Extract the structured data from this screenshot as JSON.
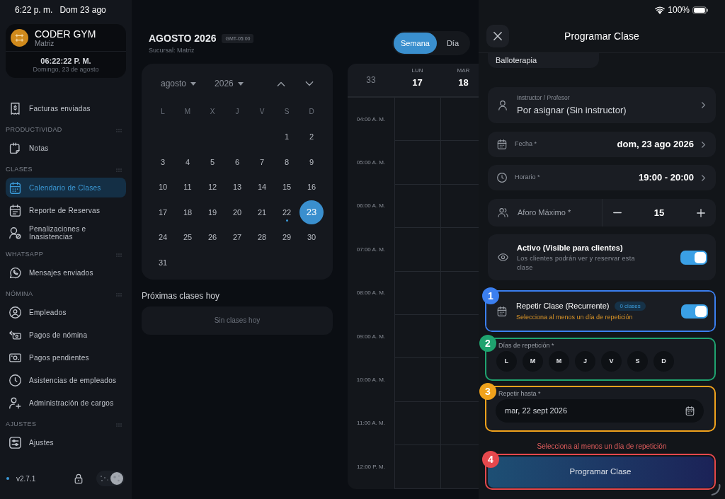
{
  "status_bar": {
    "time": "6:22 p. m.",
    "date": "Dom 23 ago",
    "battery": "100%"
  },
  "sidebar": {
    "brand": {
      "name": "CODER GYM",
      "branch": "Matriz",
      "clock": "06:22:22 P. M.",
      "date": "Domingo, 23 de agosto"
    },
    "sections": [
      {
        "items": [
          {
            "label": "Facturas enviadas",
            "selected": false
          }
        ]
      },
      {
        "title": "PRODUCTIVIDAD",
        "items": [
          {
            "label": "Notas",
            "selected": false
          }
        ]
      },
      {
        "title": "CLASES",
        "items": [
          {
            "label": "Calendario de Clases",
            "selected": true
          },
          {
            "label": "Reporte de Reservas",
            "selected": false
          },
          {
            "label": "Penalizaciones e Inasistencias",
            "selected": false
          }
        ]
      },
      {
        "title": "WHATSAPP",
        "items": [
          {
            "label": "Mensajes enviados",
            "selected": false
          }
        ]
      },
      {
        "title": "NÓMINA",
        "items": [
          {
            "label": "Empleados",
            "selected": false
          },
          {
            "label": "Pagos de nómina",
            "selected": false
          },
          {
            "label": "Pagos pendientes",
            "selected": false
          },
          {
            "label": "Asistencias de empleados",
            "selected": false
          },
          {
            "label": "Administración de cargos",
            "selected": false
          }
        ]
      },
      {
        "title": "AJUSTES",
        "items": [
          {
            "label": "Ajustes",
            "selected": false
          }
        ]
      }
    ],
    "version": "v2.7.1",
    "dark_mode": true
  },
  "header": {
    "title": "AGOSTO 2026",
    "timezone": "GMT-05:00",
    "branch": "Sucursal: Matriz"
  },
  "view_switch": [
    {
      "label": "Semana",
      "selected": true
    },
    {
      "label": "Día",
      "selected": false
    }
  ],
  "mini_calendar": {
    "month": "agosto",
    "year": "2026",
    "weekdays": [
      "L",
      "M",
      "X",
      "J",
      "V",
      "S",
      "D"
    ],
    "weeks": [
      [
        {
          "day": "1",
          "selected": false,
          "has_class": false
        },
        {
          "day": "2",
          "selected": false,
          "has_class": false
        }
      ],
      [
        {
          "day": "3",
          "selected": false,
          "has_class": false
        },
        {
          "day": "4",
          "selected": false,
          "has_class": false
        },
        {
          "day": "5",
          "selected": false,
          "has_class": false
        },
        {
          "day": "6",
          "selected": false,
          "has_class": false
        },
        {
          "day": "7",
          "selected": false,
          "has_class": false
        },
        {
          "day": "8",
          "selected": false,
          "has_class": false
        },
        {
          "day": "9",
          "selected": false,
          "has_class": false
        }
      ],
      [
        {
          "day": "10",
          "selected": false,
          "has_class": false
        },
        {
          "day": "11",
          "selected": false,
          "has_class": false
        },
        {
          "day": "12",
          "selected": false,
          "has_class": false
        },
        {
          "day": "13",
          "selected": false,
          "has_class": false
        },
        {
          "day": "14",
          "selected": false,
          "has_class": false
        },
        {
          "day": "15",
          "selected": false,
          "has_class": false
        },
        {
          "day": "16",
          "selected": false,
          "has_class": false
        }
      ],
      [
        {
          "day": "17",
          "selected": false,
          "has_class": false
        },
        {
          "day": "18",
          "selected": false,
          "has_class": false
        },
        {
          "day": "19",
          "selected": false,
          "has_class": false
        },
        {
          "day": "20",
          "selected": false,
          "has_class": false
        },
        {
          "day": "21",
          "selected": false,
          "has_class": false
        },
        {
          "day": "22",
          "selected": false,
          "has_class": true
        },
        {
          "day": "23",
          "selected": true,
          "has_class": false
        }
      ],
      [
        {
          "day": "24",
          "selected": false,
          "has_class": false
        },
        {
          "day": "25",
          "selected": false,
          "has_class": false
        },
        {
          "day": "26",
          "selected": false,
          "has_class": false
        },
        {
          "day": "27",
          "selected": false,
          "has_class": false
        },
        {
          "day": "28",
          "selected": false,
          "has_class": false
        },
        {
          "day": "29",
          "selected": false,
          "has_class": false
        },
        {
          "day": "30",
          "selected": false,
          "has_class": false
        }
      ],
      [
        {
          "day": "31",
          "selected": false,
          "has_class": false
        }
      ]
    ]
  },
  "upcoming": {
    "title": "Próximas clases hoy",
    "empty_text": "Sin clases hoy"
  },
  "week_view": {
    "week_number": "33",
    "days": [
      {
        "weekday": "LUN",
        "date": "17"
      },
      {
        "weekday": "MAR",
        "date": "18"
      }
    ],
    "hours": [
      "04:00 A. M.",
      "05:00 A. M.",
      "06:00 A. M.",
      "07:00 A. M.",
      "08:00 A. M.",
      "09:00 A. M.",
      "10:00 A. M.",
      "11:00 A. M.",
      "12:00 P. M."
    ]
  },
  "panel": {
    "title": "Programar Clase",
    "class_name": "Balloterapia",
    "instructor": {
      "label": "Instructor / Profesor",
      "value": "Por asignar (Sin instructor)"
    },
    "date": {
      "label": "Fecha *",
      "value": "dom, 23 ago 2026"
    },
    "time": {
      "label": "Horario *",
      "value": "19:00 - 20:00"
    },
    "capacity": {
      "label": "Aforo Máximo *",
      "value": "15"
    },
    "active": {
      "title": "Activo (Visible para clientes)",
      "description": "Los clientes podrán ver y reservar esta clase",
      "on": true
    },
    "repeat": {
      "title": "Repetir Clase (Recurrente)",
      "badge": "0 clases",
      "warning": "Selecciona al menos un día de repetición",
      "on": true
    },
    "repeat_days": {
      "label": "Días de repetición *",
      "days": [
        {
          "label": "L",
          "selected": false
        },
        {
          "label": "M",
          "selected": false
        },
        {
          "label": "M",
          "selected": false
        },
        {
          "label": "J",
          "selected": false
        },
        {
          "label": "V",
          "selected": false
        },
        {
          "label": "S",
          "selected": false
        },
        {
          "label": "D",
          "selected": false
        }
      ]
    },
    "repeat_until": {
      "label": "Repetir hasta *",
      "value": "mar, 22 sept 2026"
    },
    "error": "Selecciona al menos un día de repetición",
    "submit": "Programar Clase"
  },
  "annotations": [
    {
      "number": "1",
      "color": "#3b7ff0"
    },
    {
      "number": "2",
      "color": "#1fa36f"
    },
    {
      "number": "3",
      "color": "#f0a21c"
    },
    {
      "number": "4",
      "color": "#e5484d"
    }
  ]
}
